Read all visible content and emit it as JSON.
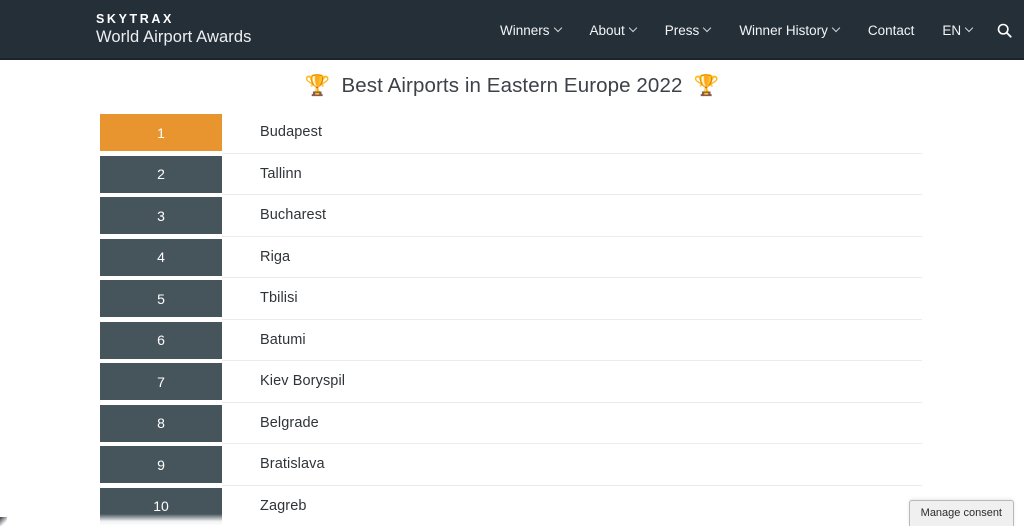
{
  "header": {
    "brand_top": "SKYTRAX",
    "brand_sub": "World Airport Awards",
    "nav": [
      {
        "label": "Winners",
        "has_caret": true
      },
      {
        "label": "About",
        "has_caret": true
      },
      {
        "label": "Press",
        "has_caret": true
      },
      {
        "label": "Winner History",
        "has_caret": true
      },
      {
        "label": "Contact",
        "has_caret": false
      },
      {
        "label": "EN",
        "has_caret": true
      }
    ],
    "search_icon": "search-icon",
    "background_color": "#252f38"
  },
  "page": {
    "title": "Best Airports in Eastern Europe 2022",
    "trophy_left": "🏆",
    "trophy_right": "🏆"
  },
  "ranking": {
    "first_place_color": "#e8952f",
    "badge_color": "#46555c",
    "rows": [
      {
        "rank": "1",
        "name": "Budapest"
      },
      {
        "rank": "2",
        "name": "Tallinn"
      },
      {
        "rank": "3",
        "name": "Bucharest"
      },
      {
        "rank": "4",
        "name": "Riga"
      },
      {
        "rank": "5",
        "name": "Tbilisi"
      },
      {
        "rank": "6",
        "name": "Batumi"
      },
      {
        "rank": "7",
        "name": "Kiev Boryspil"
      },
      {
        "rank": "8",
        "name": "Belgrade"
      },
      {
        "rank": "9",
        "name": "Bratislava"
      },
      {
        "rank": "10",
        "name": "Zagreb"
      }
    ]
  },
  "consent": {
    "label": "Manage consent"
  }
}
